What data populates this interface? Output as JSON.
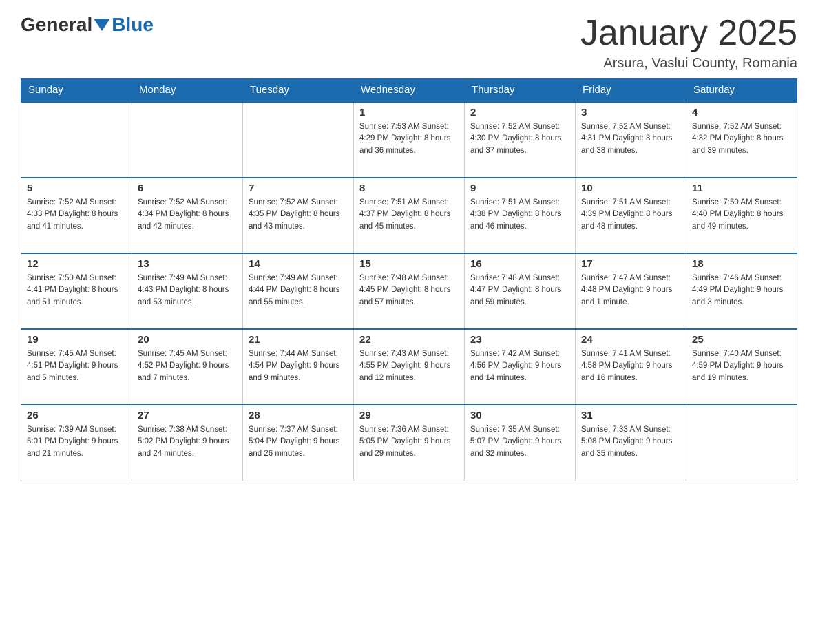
{
  "header": {
    "logo_general": "General",
    "logo_blue": "Blue",
    "month_title": "January 2025",
    "location": "Arsura, Vaslui County, Romania"
  },
  "days_of_week": [
    "Sunday",
    "Monday",
    "Tuesday",
    "Wednesday",
    "Thursday",
    "Friday",
    "Saturday"
  ],
  "weeks": [
    [
      {
        "day": "",
        "info": ""
      },
      {
        "day": "",
        "info": ""
      },
      {
        "day": "",
        "info": ""
      },
      {
        "day": "1",
        "info": "Sunrise: 7:53 AM\nSunset: 4:29 PM\nDaylight: 8 hours\nand 36 minutes."
      },
      {
        "day": "2",
        "info": "Sunrise: 7:52 AM\nSunset: 4:30 PM\nDaylight: 8 hours\nand 37 minutes."
      },
      {
        "day": "3",
        "info": "Sunrise: 7:52 AM\nSunset: 4:31 PM\nDaylight: 8 hours\nand 38 minutes."
      },
      {
        "day": "4",
        "info": "Sunrise: 7:52 AM\nSunset: 4:32 PM\nDaylight: 8 hours\nand 39 minutes."
      }
    ],
    [
      {
        "day": "5",
        "info": "Sunrise: 7:52 AM\nSunset: 4:33 PM\nDaylight: 8 hours\nand 41 minutes."
      },
      {
        "day": "6",
        "info": "Sunrise: 7:52 AM\nSunset: 4:34 PM\nDaylight: 8 hours\nand 42 minutes."
      },
      {
        "day": "7",
        "info": "Sunrise: 7:52 AM\nSunset: 4:35 PM\nDaylight: 8 hours\nand 43 minutes."
      },
      {
        "day": "8",
        "info": "Sunrise: 7:51 AM\nSunset: 4:37 PM\nDaylight: 8 hours\nand 45 minutes."
      },
      {
        "day": "9",
        "info": "Sunrise: 7:51 AM\nSunset: 4:38 PM\nDaylight: 8 hours\nand 46 minutes."
      },
      {
        "day": "10",
        "info": "Sunrise: 7:51 AM\nSunset: 4:39 PM\nDaylight: 8 hours\nand 48 minutes."
      },
      {
        "day": "11",
        "info": "Sunrise: 7:50 AM\nSunset: 4:40 PM\nDaylight: 8 hours\nand 49 minutes."
      }
    ],
    [
      {
        "day": "12",
        "info": "Sunrise: 7:50 AM\nSunset: 4:41 PM\nDaylight: 8 hours\nand 51 minutes."
      },
      {
        "day": "13",
        "info": "Sunrise: 7:49 AM\nSunset: 4:43 PM\nDaylight: 8 hours\nand 53 minutes."
      },
      {
        "day": "14",
        "info": "Sunrise: 7:49 AM\nSunset: 4:44 PM\nDaylight: 8 hours\nand 55 minutes."
      },
      {
        "day": "15",
        "info": "Sunrise: 7:48 AM\nSunset: 4:45 PM\nDaylight: 8 hours\nand 57 minutes."
      },
      {
        "day": "16",
        "info": "Sunrise: 7:48 AM\nSunset: 4:47 PM\nDaylight: 8 hours\nand 59 minutes."
      },
      {
        "day": "17",
        "info": "Sunrise: 7:47 AM\nSunset: 4:48 PM\nDaylight: 9 hours\nand 1 minute."
      },
      {
        "day": "18",
        "info": "Sunrise: 7:46 AM\nSunset: 4:49 PM\nDaylight: 9 hours\nand 3 minutes."
      }
    ],
    [
      {
        "day": "19",
        "info": "Sunrise: 7:45 AM\nSunset: 4:51 PM\nDaylight: 9 hours\nand 5 minutes."
      },
      {
        "day": "20",
        "info": "Sunrise: 7:45 AM\nSunset: 4:52 PM\nDaylight: 9 hours\nand 7 minutes."
      },
      {
        "day": "21",
        "info": "Sunrise: 7:44 AM\nSunset: 4:54 PM\nDaylight: 9 hours\nand 9 minutes."
      },
      {
        "day": "22",
        "info": "Sunrise: 7:43 AM\nSunset: 4:55 PM\nDaylight: 9 hours\nand 12 minutes."
      },
      {
        "day": "23",
        "info": "Sunrise: 7:42 AM\nSunset: 4:56 PM\nDaylight: 9 hours\nand 14 minutes."
      },
      {
        "day": "24",
        "info": "Sunrise: 7:41 AM\nSunset: 4:58 PM\nDaylight: 9 hours\nand 16 minutes."
      },
      {
        "day": "25",
        "info": "Sunrise: 7:40 AM\nSunset: 4:59 PM\nDaylight: 9 hours\nand 19 minutes."
      }
    ],
    [
      {
        "day": "26",
        "info": "Sunrise: 7:39 AM\nSunset: 5:01 PM\nDaylight: 9 hours\nand 21 minutes."
      },
      {
        "day": "27",
        "info": "Sunrise: 7:38 AM\nSunset: 5:02 PM\nDaylight: 9 hours\nand 24 minutes."
      },
      {
        "day": "28",
        "info": "Sunrise: 7:37 AM\nSunset: 5:04 PM\nDaylight: 9 hours\nand 26 minutes."
      },
      {
        "day": "29",
        "info": "Sunrise: 7:36 AM\nSunset: 5:05 PM\nDaylight: 9 hours\nand 29 minutes."
      },
      {
        "day": "30",
        "info": "Sunrise: 7:35 AM\nSunset: 5:07 PM\nDaylight: 9 hours\nand 32 minutes."
      },
      {
        "day": "31",
        "info": "Sunrise: 7:33 AM\nSunset: 5:08 PM\nDaylight: 9 hours\nand 35 minutes."
      },
      {
        "day": "",
        "info": ""
      }
    ]
  ]
}
